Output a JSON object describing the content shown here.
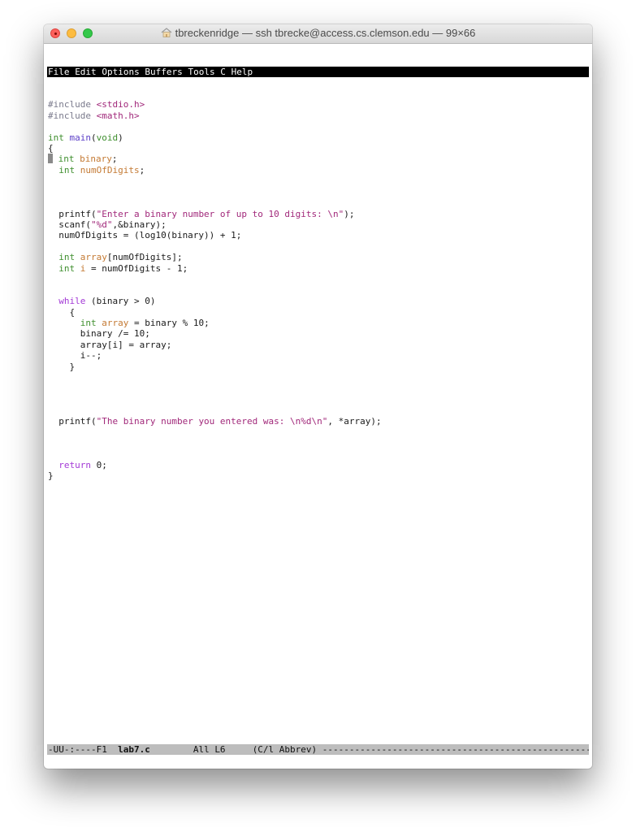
{
  "window": {
    "title": "tbreckenridge — ssh tbrecke@access.cs.clemson.edu — 99×66",
    "title_icon": "home-icon"
  },
  "menubar": {
    "items": [
      "File",
      "Edit",
      "Options",
      "Buffers",
      "Tools",
      "C",
      "Help"
    ]
  },
  "editor": {
    "lines": [
      [
        {
          "t": "#include ",
          "c": "pp"
        },
        {
          "t": "<stdio.h>",
          "c": "str"
        }
      ],
      [
        {
          "t": "#include ",
          "c": "pp"
        },
        {
          "t": "<math.h>",
          "c": "str"
        }
      ],
      [],
      [
        {
          "t": "int ",
          "c": "kw-type"
        },
        {
          "t": "main",
          "c": "kw-fn"
        },
        {
          "t": "(",
          "c": ""
        },
        {
          "t": "void",
          "c": "kw-type"
        },
        {
          "t": ")",
          "c": ""
        }
      ],
      [
        {
          "t": "{",
          "c": ""
        }
      ],
      [
        {
          "t": "CURSOR",
          "c": "cursor"
        },
        {
          "t": " ",
          "c": ""
        },
        {
          "t": "int ",
          "c": "kw-type"
        },
        {
          "t": "binary",
          "c": "var"
        },
        {
          "t": ";",
          "c": ""
        }
      ],
      [
        {
          "t": "  ",
          "c": ""
        },
        {
          "t": "int ",
          "c": "kw-type"
        },
        {
          "t": "numOfDigits",
          "c": "var"
        },
        {
          "t": ";",
          "c": ""
        }
      ],
      [],
      [],
      [],
      [
        {
          "t": "  printf(",
          "c": ""
        },
        {
          "t": "\"Enter a binary number of up to 10 digits: \\n\"",
          "c": "str"
        },
        {
          "t": ");",
          "c": ""
        }
      ],
      [
        {
          "t": "  scanf(",
          "c": ""
        },
        {
          "t": "\"%d\"",
          "c": "str"
        },
        {
          "t": ",&binary);",
          "c": ""
        }
      ],
      [
        {
          "t": "  numOfDigits = (log10(binary)) + 1;",
          "c": ""
        }
      ],
      [],
      [
        {
          "t": "  ",
          "c": ""
        },
        {
          "t": "int ",
          "c": "kw-type"
        },
        {
          "t": "array",
          "c": "var"
        },
        {
          "t": "[numOfDigits];",
          "c": ""
        }
      ],
      [
        {
          "t": "  ",
          "c": ""
        },
        {
          "t": "int ",
          "c": "kw-type"
        },
        {
          "t": "i",
          "c": "var"
        },
        {
          "t": " = numOfDigits - 1;",
          "c": ""
        }
      ],
      [],
      [],
      [
        {
          "t": "  ",
          "c": ""
        },
        {
          "t": "while",
          "c": "kw-ctrl"
        },
        {
          "t": " (binary > 0)",
          "c": ""
        }
      ],
      [
        {
          "t": "    {",
          "c": ""
        }
      ],
      [
        {
          "t": "      ",
          "c": ""
        },
        {
          "t": "int ",
          "c": "kw-type"
        },
        {
          "t": "array",
          "c": "var"
        },
        {
          "t": " = binary % 10;",
          "c": ""
        }
      ],
      [
        {
          "t": "      binary /= 10;",
          "c": ""
        }
      ],
      [
        {
          "t": "      array[i] = array;",
          "c": ""
        }
      ],
      [
        {
          "t": "      i--;",
          "c": ""
        }
      ],
      [
        {
          "t": "    }",
          "c": ""
        }
      ],
      [],
      [],
      [],
      [],
      [
        {
          "t": "  printf(",
          "c": ""
        },
        {
          "t": "\"The binary number you entered was: \\n%d\\n\"",
          "c": "str"
        },
        {
          "t": ", *array);",
          "c": ""
        }
      ],
      [],
      [],
      [],
      [
        {
          "t": "  ",
          "c": ""
        },
        {
          "t": "return",
          "c": "kw-ctrl"
        },
        {
          "t": " 0;",
          "c": ""
        }
      ],
      [
        {
          "t": "}",
          "c": ""
        }
      ]
    ]
  },
  "modeline": {
    "status": "-UU-:----F1  ",
    "buffer_name": "lab7.c",
    "position": "        All L6     ",
    "mode": "(C/l Abbrev) ",
    "fill": "----------------------------------------------------------------"
  },
  "colors": {
    "close": "#fc605c",
    "minimize": "#fdbc40",
    "maximize": "#34c84a",
    "type_keyword": "#3f8f2e",
    "function_name": "#5d40c8",
    "control_keyword": "#a339d6",
    "variable": "#c47a34",
    "string": "#a1287a",
    "preprocessor": "#7a7a8c",
    "modeline_bg": "#bdbdbd"
  }
}
